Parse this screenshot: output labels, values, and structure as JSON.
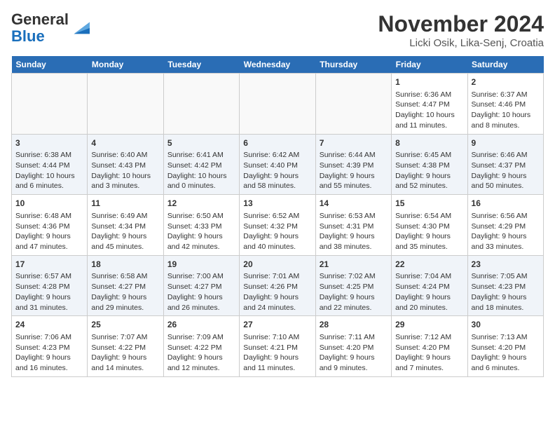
{
  "logo": {
    "general": "General",
    "blue": "Blue"
  },
  "header": {
    "title": "November 2024",
    "subtitle": "Licki Osik, Lika-Senj, Croatia"
  },
  "columns": [
    "Sunday",
    "Monday",
    "Tuesday",
    "Wednesday",
    "Thursday",
    "Friday",
    "Saturday"
  ],
  "weeks": [
    {
      "days": [
        {
          "num": "",
          "info": "",
          "empty": true
        },
        {
          "num": "",
          "info": "",
          "empty": true
        },
        {
          "num": "",
          "info": "",
          "empty": true
        },
        {
          "num": "",
          "info": "",
          "empty": true
        },
        {
          "num": "",
          "info": "",
          "empty": true
        },
        {
          "num": "1",
          "info": "Sunrise: 6:36 AM\nSunset: 4:47 PM\nDaylight: 10 hours and 11 minutes.",
          "empty": false
        },
        {
          "num": "2",
          "info": "Sunrise: 6:37 AM\nSunset: 4:46 PM\nDaylight: 10 hours and 8 minutes.",
          "empty": false
        }
      ]
    },
    {
      "days": [
        {
          "num": "3",
          "info": "Sunrise: 6:38 AM\nSunset: 4:44 PM\nDaylight: 10 hours and 6 minutes.",
          "empty": false
        },
        {
          "num": "4",
          "info": "Sunrise: 6:40 AM\nSunset: 4:43 PM\nDaylight: 10 hours and 3 minutes.",
          "empty": false
        },
        {
          "num": "5",
          "info": "Sunrise: 6:41 AM\nSunset: 4:42 PM\nDaylight: 10 hours and 0 minutes.",
          "empty": false
        },
        {
          "num": "6",
          "info": "Sunrise: 6:42 AM\nSunset: 4:40 PM\nDaylight: 9 hours and 58 minutes.",
          "empty": false
        },
        {
          "num": "7",
          "info": "Sunrise: 6:44 AM\nSunset: 4:39 PM\nDaylight: 9 hours and 55 minutes.",
          "empty": false
        },
        {
          "num": "8",
          "info": "Sunrise: 6:45 AM\nSunset: 4:38 PM\nDaylight: 9 hours and 52 minutes.",
          "empty": false
        },
        {
          "num": "9",
          "info": "Sunrise: 6:46 AM\nSunset: 4:37 PM\nDaylight: 9 hours and 50 minutes.",
          "empty": false
        }
      ]
    },
    {
      "days": [
        {
          "num": "10",
          "info": "Sunrise: 6:48 AM\nSunset: 4:36 PM\nDaylight: 9 hours and 47 minutes.",
          "empty": false
        },
        {
          "num": "11",
          "info": "Sunrise: 6:49 AM\nSunset: 4:34 PM\nDaylight: 9 hours and 45 minutes.",
          "empty": false
        },
        {
          "num": "12",
          "info": "Sunrise: 6:50 AM\nSunset: 4:33 PM\nDaylight: 9 hours and 42 minutes.",
          "empty": false
        },
        {
          "num": "13",
          "info": "Sunrise: 6:52 AM\nSunset: 4:32 PM\nDaylight: 9 hours and 40 minutes.",
          "empty": false
        },
        {
          "num": "14",
          "info": "Sunrise: 6:53 AM\nSunset: 4:31 PM\nDaylight: 9 hours and 38 minutes.",
          "empty": false
        },
        {
          "num": "15",
          "info": "Sunrise: 6:54 AM\nSunset: 4:30 PM\nDaylight: 9 hours and 35 minutes.",
          "empty": false
        },
        {
          "num": "16",
          "info": "Sunrise: 6:56 AM\nSunset: 4:29 PM\nDaylight: 9 hours and 33 minutes.",
          "empty": false
        }
      ]
    },
    {
      "days": [
        {
          "num": "17",
          "info": "Sunrise: 6:57 AM\nSunset: 4:28 PM\nDaylight: 9 hours and 31 minutes.",
          "empty": false
        },
        {
          "num": "18",
          "info": "Sunrise: 6:58 AM\nSunset: 4:27 PM\nDaylight: 9 hours and 29 minutes.",
          "empty": false
        },
        {
          "num": "19",
          "info": "Sunrise: 7:00 AM\nSunset: 4:27 PM\nDaylight: 9 hours and 26 minutes.",
          "empty": false
        },
        {
          "num": "20",
          "info": "Sunrise: 7:01 AM\nSunset: 4:26 PM\nDaylight: 9 hours and 24 minutes.",
          "empty": false
        },
        {
          "num": "21",
          "info": "Sunrise: 7:02 AM\nSunset: 4:25 PM\nDaylight: 9 hours and 22 minutes.",
          "empty": false
        },
        {
          "num": "22",
          "info": "Sunrise: 7:04 AM\nSunset: 4:24 PM\nDaylight: 9 hours and 20 minutes.",
          "empty": false
        },
        {
          "num": "23",
          "info": "Sunrise: 7:05 AM\nSunset: 4:23 PM\nDaylight: 9 hours and 18 minutes.",
          "empty": false
        }
      ]
    },
    {
      "days": [
        {
          "num": "24",
          "info": "Sunrise: 7:06 AM\nSunset: 4:23 PM\nDaylight: 9 hours and 16 minutes.",
          "empty": false
        },
        {
          "num": "25",
          "info": "Sunrise: 7:07 AM\nSunset: 4:22 PM\nDaylight: 9 hours and 14 minutes.",
          "empty": false
        },
        {
          "num": "26",
          "info": "Sunrise: 7:09 AM\nSunset: 4:22 PM\nDaylight: 9 hours and 12 minutes.",
          "empty": false
        },
        {
          "num": "27",
          "info": "Sunrise: 7:10 AM\nSunset: 4:21 PM\nDaylight: 9 hours and 11 minutes.",
          "empty": false
        },
        {
          "num": "28",
          "info": "Sunrise: 7:11 AM\nSunset: 4:20 PM\nDaylight: 9 hours and 9 minutes.",
          "empty": false
        },
        {
          "num": "29",
          "info": "Sunrise: 7:12 AM\nSunset: 4:20 PM\nDaylight: 9 hours and 7 minutes.",
          "empty": false
        },
        {
          "num": "30",
          "info": "Sunrise: 7:13 AM\nSunset: 4:20 PM\nDaylight: 9 hours and 6 minutes.",
          "empty": false
        }
      ]
    }
  ]
}
